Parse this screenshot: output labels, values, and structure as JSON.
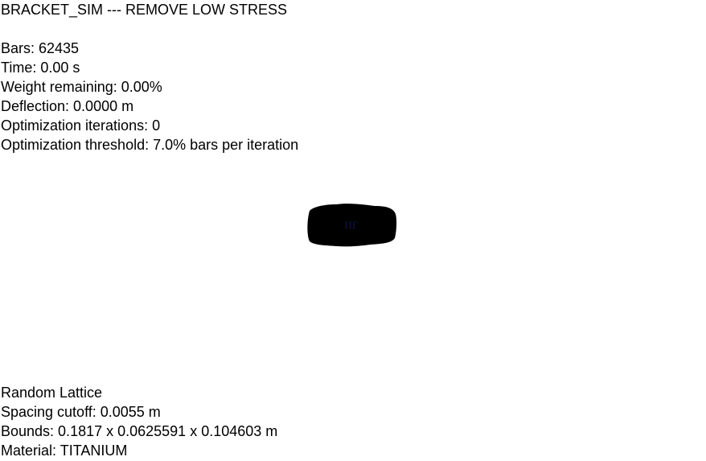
{
  "title": "BRACKET_SIM --- REMOVE LOW STRESS",
  "stats": {
    "bars": "Bars: 62435",
    "time": "Time: 0.00 s",
    "weight": "Weight remaining: 0.00%",
    "deflection": "Deflection: 0.0000 m",
    "iterations": "Optimization iterations: 0",
    "threshold": "Optimization threshold: 7.0% bars per iteration"
  },
  "info": {
    "lattice": "Random Lattice",
    "spacing": "Spacing cutoff: 0.0055 m",
    "bounds": "Bounds: 0.1817 x 0.0625591 x 0.104603 m",
    "material": "Material: TITANIUM"
  },
  "colors": {
    "background": "#ffffff",
    "text": "#000000",
    "lattice": "#000000",
    "lattice_inner": "#1a1a6e"
  }
}
